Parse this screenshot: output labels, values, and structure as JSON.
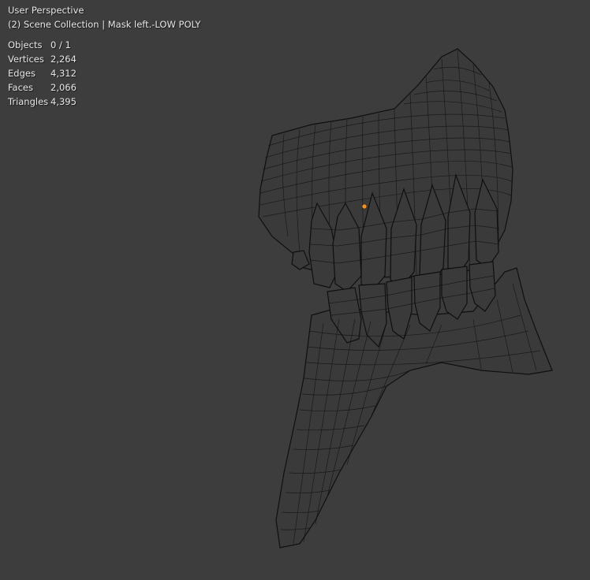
{
  "viewport": {
    "view_name": "User Perspective",
    "collection_info": "(2) Scene Collection | Mask left.-LOW POLY",
    "stats": [
      {
        "label": "Objects",
        "value": "0 / 1"
      },
      {
        "label": "Vertices",
        "value": "2,264"
      },
      {
        "label": "Edges",
        "value": "4,312"
      },
      {
        "label": "Faces",
        "value": "2,066"
      },
      {
        "label": "Triangles",
        "value": "4,395"
      }
    ]
  },
  "colors": {
    "background": "#3d3d3d",
    "wireframe": "#141414",
    "origin_point": "#f0922b",
    "text": "#e6e6e6"
  }
}
